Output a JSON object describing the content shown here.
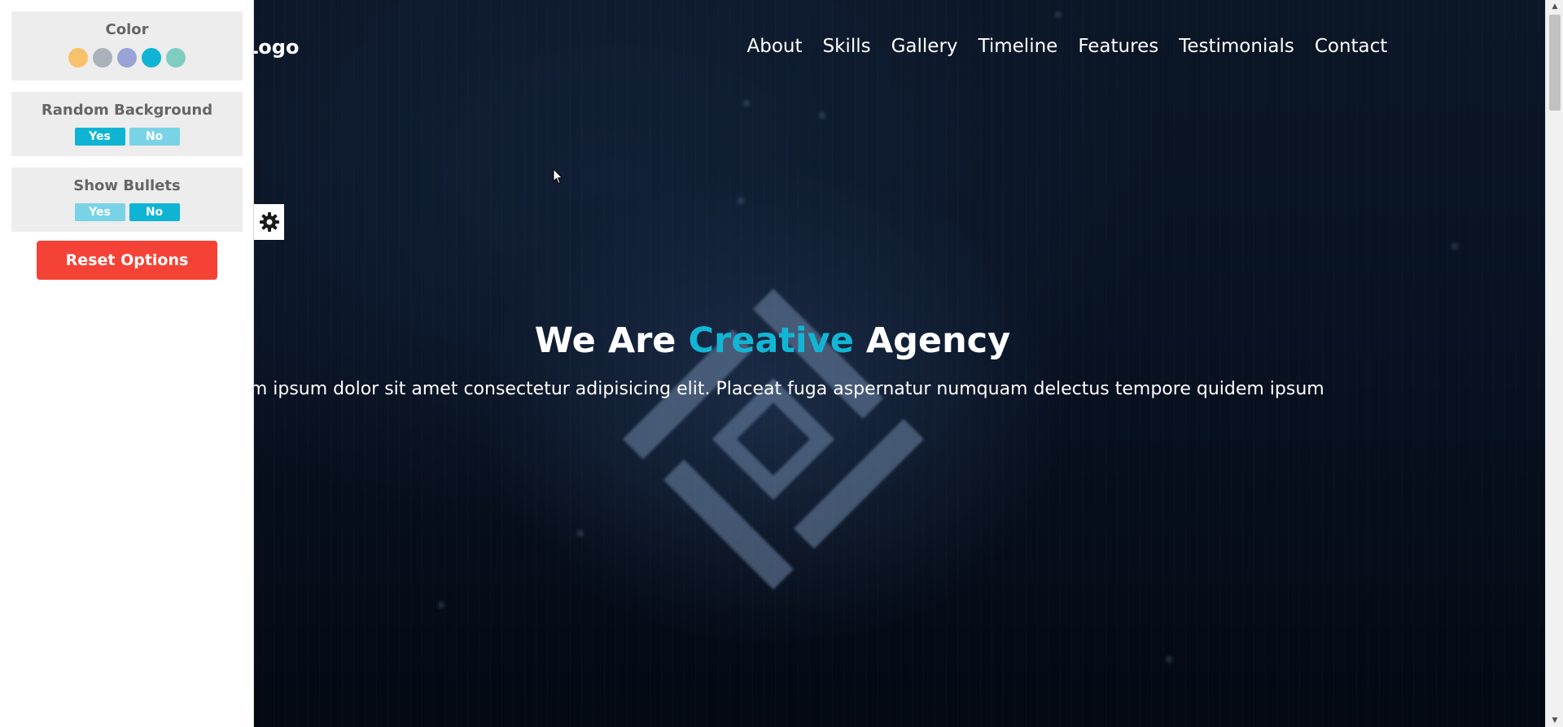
{
  "settings": {
    "color": {
      "title": "Color",
      "swatches": [
        {
          "name": "orange",
          "color": "#f7c26b"
        },
        {
          "name": "gray",
          "color": "#a8b3bb"
        },
        {
          "name": "lavender",
          "color": "#9aa3d6"
        },
        {
          "name": "cyan",
          "color": "#0fb4d4"
        },
        {
          "name": "teal",
          "color": "#7fcdc0"
        }
      ]
    },
    "random_background": {
      "title": "Random Background",
      "yes_label": "Yes",
      "no_label": "No",
      "selected": "Yes"
    },
    "show_bullets": {
      "title": "Show Bullets",
      "yes_label": "Yes",
      "no_label": "No",
      "selected": "No"
    },
    "reset_label": "Reset Options"
  },
  "header": {
    "logo_text": "ial Logo",
    "nav": [
      "About",
      "Skills",
      "Gallery",
      "Timeline",
      "Features",
      "Testimonials",
      "Contact"
    ]
  },
  "hero": {
    "title_before": "We Are ",
    "title_accent": "Creative",
    "title_after": " Agency",
    "subtitle": "orem ipsum dolor sit amet consectetur adipisicing elit. Placeat fuga aspernatur numquam delectus tempore quidem ipsum"
  },
  "colors": {
    "accent": "#12b6d4",
    "reset_button": "#f44336",
    "panel_box": "#ededed"
  }
}
